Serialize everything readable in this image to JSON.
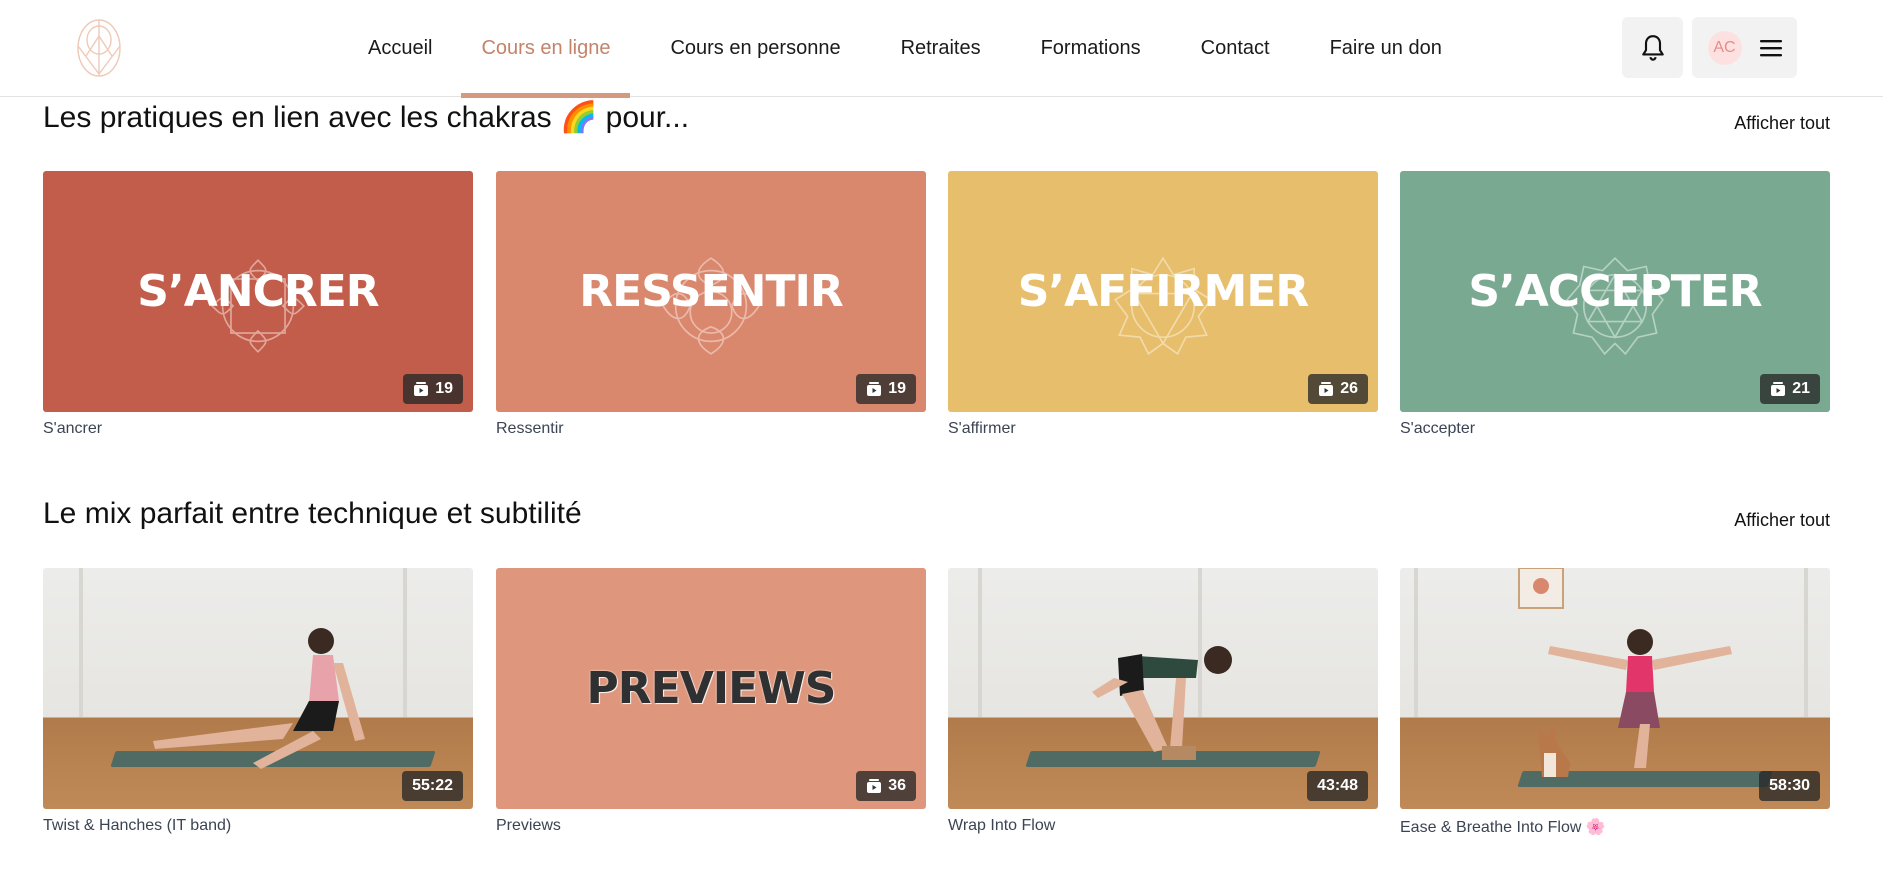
{
  "nav": {
    "items": [
      {
        "label": "Accueil"
      },
      {
        "label": "Cours en ligne",
        "active": true
      },
      {
        "label": "Cours en personne"
      },
      {
        "label": "Retraites"
      },
      {
        "label": "Formations"
      },
      {
        "label": "Contact"
      },
      {
        "label": "Faire un don"
      }
    ],
    "user_initials": "AC"
  },
  "sections": [
    {
      "title": "Les pratiques en lien avec les chakras 🌈 pour...",
      "see_all": "Afficher tout",
      "cards": [
        {
          "overlay": "S’ANCRER",
          "label": "S'ancrer",
          "badge": "19",
          "badge_icon": "playlist-icon",
          "color": "#c15d4a"
        },
        {
          "overlay": "RESSENTIR",
          "label": "Ressentir",
          "badge": "19",
          "badge_icon": "playlist-icon",
          "color": "#d9886d"
        },
        {
          "overlay": "S’AFFIRMER",
          "label": "S'affirmer",
          "badge": "26",
          "badge_icon": "playlist-icon",
          "color": "#e6be6c"
        },
        {
          "overlay": "S’ACCEPTER",
          "label": "S'accepter",
          "badge": "21",
          "badge_icon": "playlist-icon",
          "color": "#7aa991"
        }
      ]
    },
    {
      "title": "Le mix parfait entre technique et subtilité",
      "see_all": "Afficher tout",
      "cards": [
        {
          "label": "Twist & Hanches (IT band)",
          "badge": "55:22",
          "badge_icon": "none"
        },
        {
          "overlay": "PREVIEWS",
          "label": "Previews",
          "badge": "36",
          "badge_icon": "playlist-icon",
          "color": "#de967c"
        },
        {
          "label": "Wrap Into Flow",
          "badge": "43:48",
          "badge_icon": "none"
        },
        {
          "label": "Ease & Breathe Into Flow 🌸",
          "badge": "58:30",
          "badge_icon": "none"
        }
      ]
    }
  ]
}
